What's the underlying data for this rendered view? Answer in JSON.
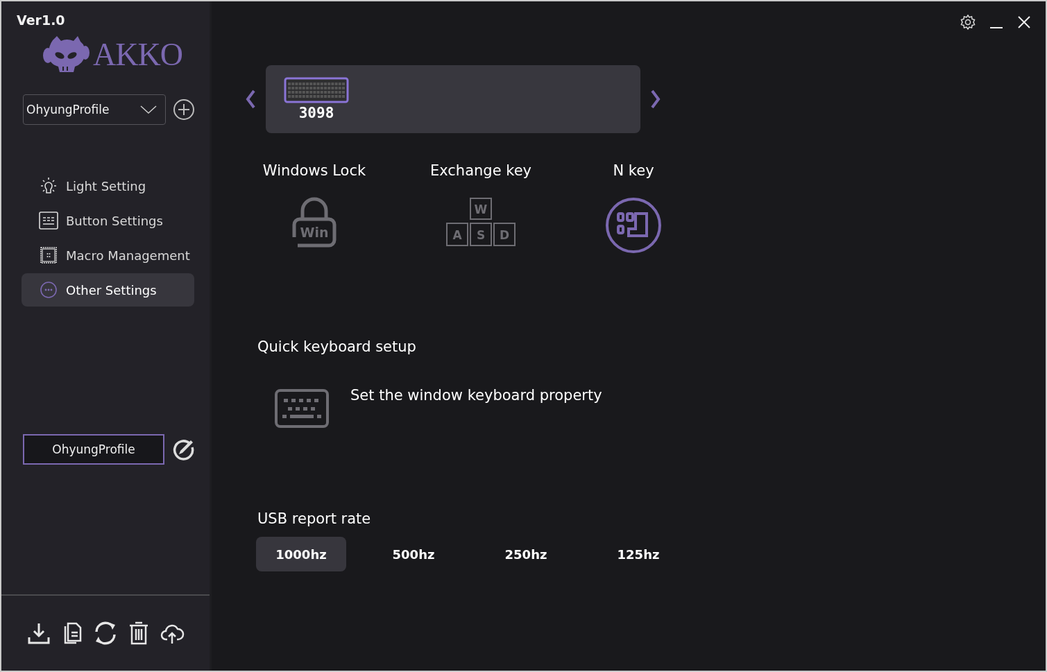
{
  "version": "Ver1.0",
  "logo": "AKKO",
  "profile_select": {
    "value": "OhyungProfile"
  },
  "nav": [
    {
      "label": "Light Setting",
      "kind": "light",
      "selected": false
    },
    {
      "label": "Button Settings",
      "kind": "button",
      "selected": false
    },
    {
      "label": "Macro Management",
      "kind": "macro",
      "selected": false
    },
    {
      "label": "Other Settings",
      "kind": "other",
      "selected": true
    }
  ],
  "profile_name": {
    "value": "OhyungProfile"
  },
  "device": {
    "name": "3098"
  },
  "features": [
    {
      "label": "Windows Lock",
      "kind": "winlock",
      "on": false
    },
    {
      "label": "Exchange key",
      "kind": "wasd",
      "on": false,
      "keys": [
        "W",
        "A",
        "S",
        "D"
      ]
    },
    {
      "label": "N key",
      "kind": "nkey",
      "on": true
    }
  ],
  "win_lock_icon_text": "Win",
  "quick_setup": {
    "title": "Quick keyboard setup",
    "text": "Set the window keyboard property"
  },
  "usb": {
    "title": "USB report rate",
    "rates": [
      {
        "label": "1000hz",
        "selected": true
      },
      {
        "label": "500hz",
        "selected": false
      },
      {
        "label": "250hz",
        "selected": false
      },
      {
        "label": "125hz",
        "selected": false
      }
    ]
  }
}
